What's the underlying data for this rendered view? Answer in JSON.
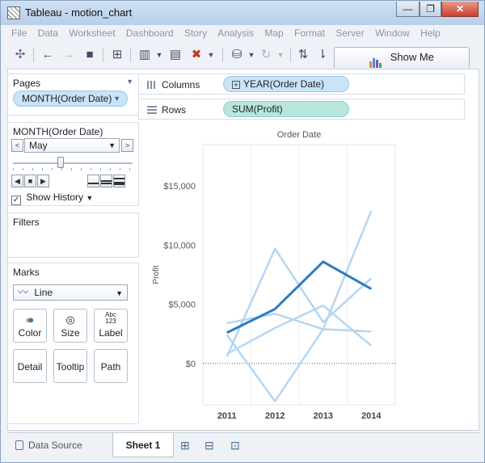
{
  "window": {
    "title": "Tableau - motion_chart",
    "minimize_glyph": "—",
    "restore_glyph": "❐",
    "close_glyph": "✕"
  },
  "menu": [
    "File",
    "Data",
    "Worksheet",
    "Dashboard",
    "Story",
    "Analysis",
    "Map",
    "Format",
    "Server",
    "Window",
    "Help"
  ],
  "toolbar": {
    "show_me_label": "Show Me",
    "icons": [
      "tableau-logo-icon",
      "undo-icon",
      "redo-icon",
      "save-icon",
      "new-datasource-icon",
      "new-worksheet-icon",
      "duplicate-sheet-icon",
      "clear-sheet-icon",
      "datasource-icon",
      "refresh-icon",
      "swap-icon",
      "sort-icon"
    ]
  },
  "pages_panel": {
    "title": "Pages",
    "pill": "MONTH(Order Date)"
  },
  "shelves": {
    "columns_label": "Columns",
    "columns_pill": "YEAR(Order Date)",
    "rows_label": "Rows",
    "rows_pill": "SUM(Profit)"
  },
  "page_control": {
    "title": "MONTH(Order Date)",
    "current": "May",
    "prev_glyph": "<",
    "next_glyph": ">",
    "show_history": "Show History",
    "slider_level": 0.4
  },
  "filters_panel": {
    "title": "Filters"
  },
  "marks_panel": {
    "title": "Marks",
    "mark_type": "Line",
    "buttons": [
      "Color",
      "Size",
      "Label",
      "Detail",
      "Tooltip",
      "Path"
    ]
  },
  "chart_data": {
    "type": "line",
    "title": "Order Date",
    "ylabel": "Profit",
    "xlabel": "",
    "categories": [
      "2011",
      "2012",
      "2013",
      "2014"
    ],
    "y_ticks": [
      "$15,000",
      "$10,000",
      "$5,000",
      "$0"
    ],
    "y_tick_values": [
      15000,
      10000,
      5000,
      0
    ],
    "ylim": [
      -3500,
      18500
    ],
    "highlight_color": "#2e7bc0",
    "history_color": "#b4d6f2",
    "history": [
      [
        2400,
        -3200,
        2900,
        12900
      ],
      [
        600,
        9700,
        3500,
        7200
      ],
      [
        3400,
        4200,
        2900,
        2700
      ],
      [
        800,
        3000,
        4900,
        1500
      ]
    ],
    "current": [
      2600,
      4600,
      8600,
      6300
    ]
  },
  "status_bar": {
    "data_source": "Data Source",
    "sheet": "Sheet 1"
  }
}
